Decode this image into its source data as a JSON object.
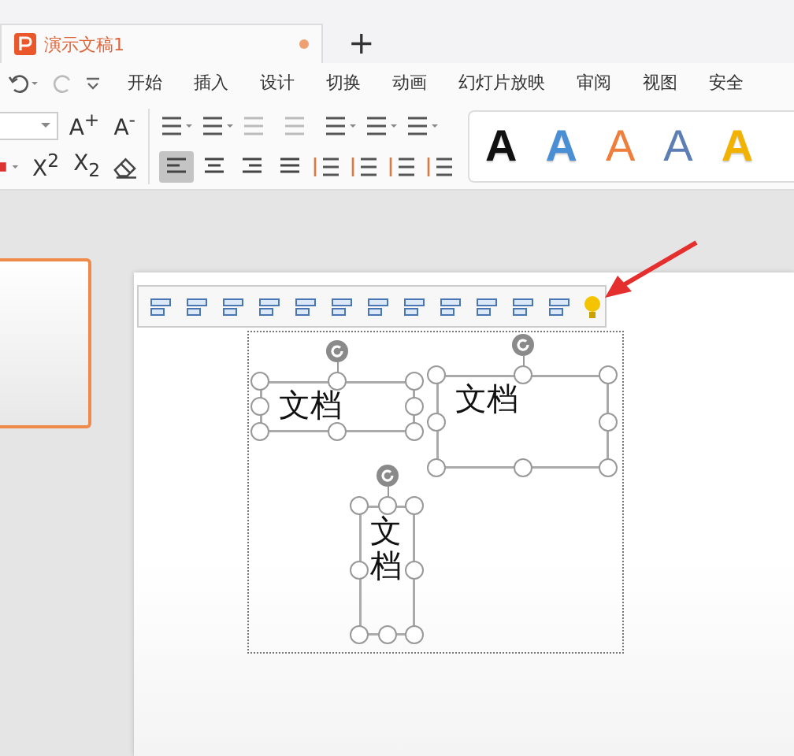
{
  "document_tab": {
    "title": "演示文稿1",
    "unsaved": true,
    "selected": true
  },
  "new_tab": "+",
  "menu": [
    {
      "label": "开始"
    },
    {
      "label": "插入"
    },
    {
      "label": "设计"
    },
    {
      "label": "切换"
    },
    {
      "label": "动画"
    },
    {
      "label": "幻灯片放映"
    },
    {
      "label": "审阅"
    },
    {
      "label": "视图"
    },
    {
      "label": "安全"
    }
  ],
  "font_buttons": [
    "A$^{+}$",
    "A$^{-}$"
  ],
  "script_buttons": [
    "X$^{2}$",
    "X$_{2}$"
  ],
  "align_buttons": [
    {
      "selected": true
    },
    {
      "selected": false
    },
    {
      "selected": false
    },
    {
      "selected": false
    }
  ],
  "wordart_styles": [
    {
      "label": "A",
      "color": "#111111",
      "kind": "solid"
    },
    {
      "label": "A",
      "color": "#4a8fd4",
      "kind": "solid"
    },
    {
      "label": "A",
      "color": "#ef7d3c",
      "kind": "outline"
    },
    {
      "label": "A",
      "color": "#5b7fb5",
      "kind": "outline"
    },
    {
      "label": "A",
      "color": "#f2b300",
      "kind": "solid"
    }
  ],
  "slide_thumbnail": {
    "selected": true
  },
  "text_boxes": [
    {
      "text": "文档",
      "kind": "horizontal",
      "selected": true
    },
    {
      "text": "文档",
      "kind": "horizontal",
      "selected": true
    },
    {
      "text": "文档",
      "kind": "vertical",
      "selected": true
    }
  ]
}
